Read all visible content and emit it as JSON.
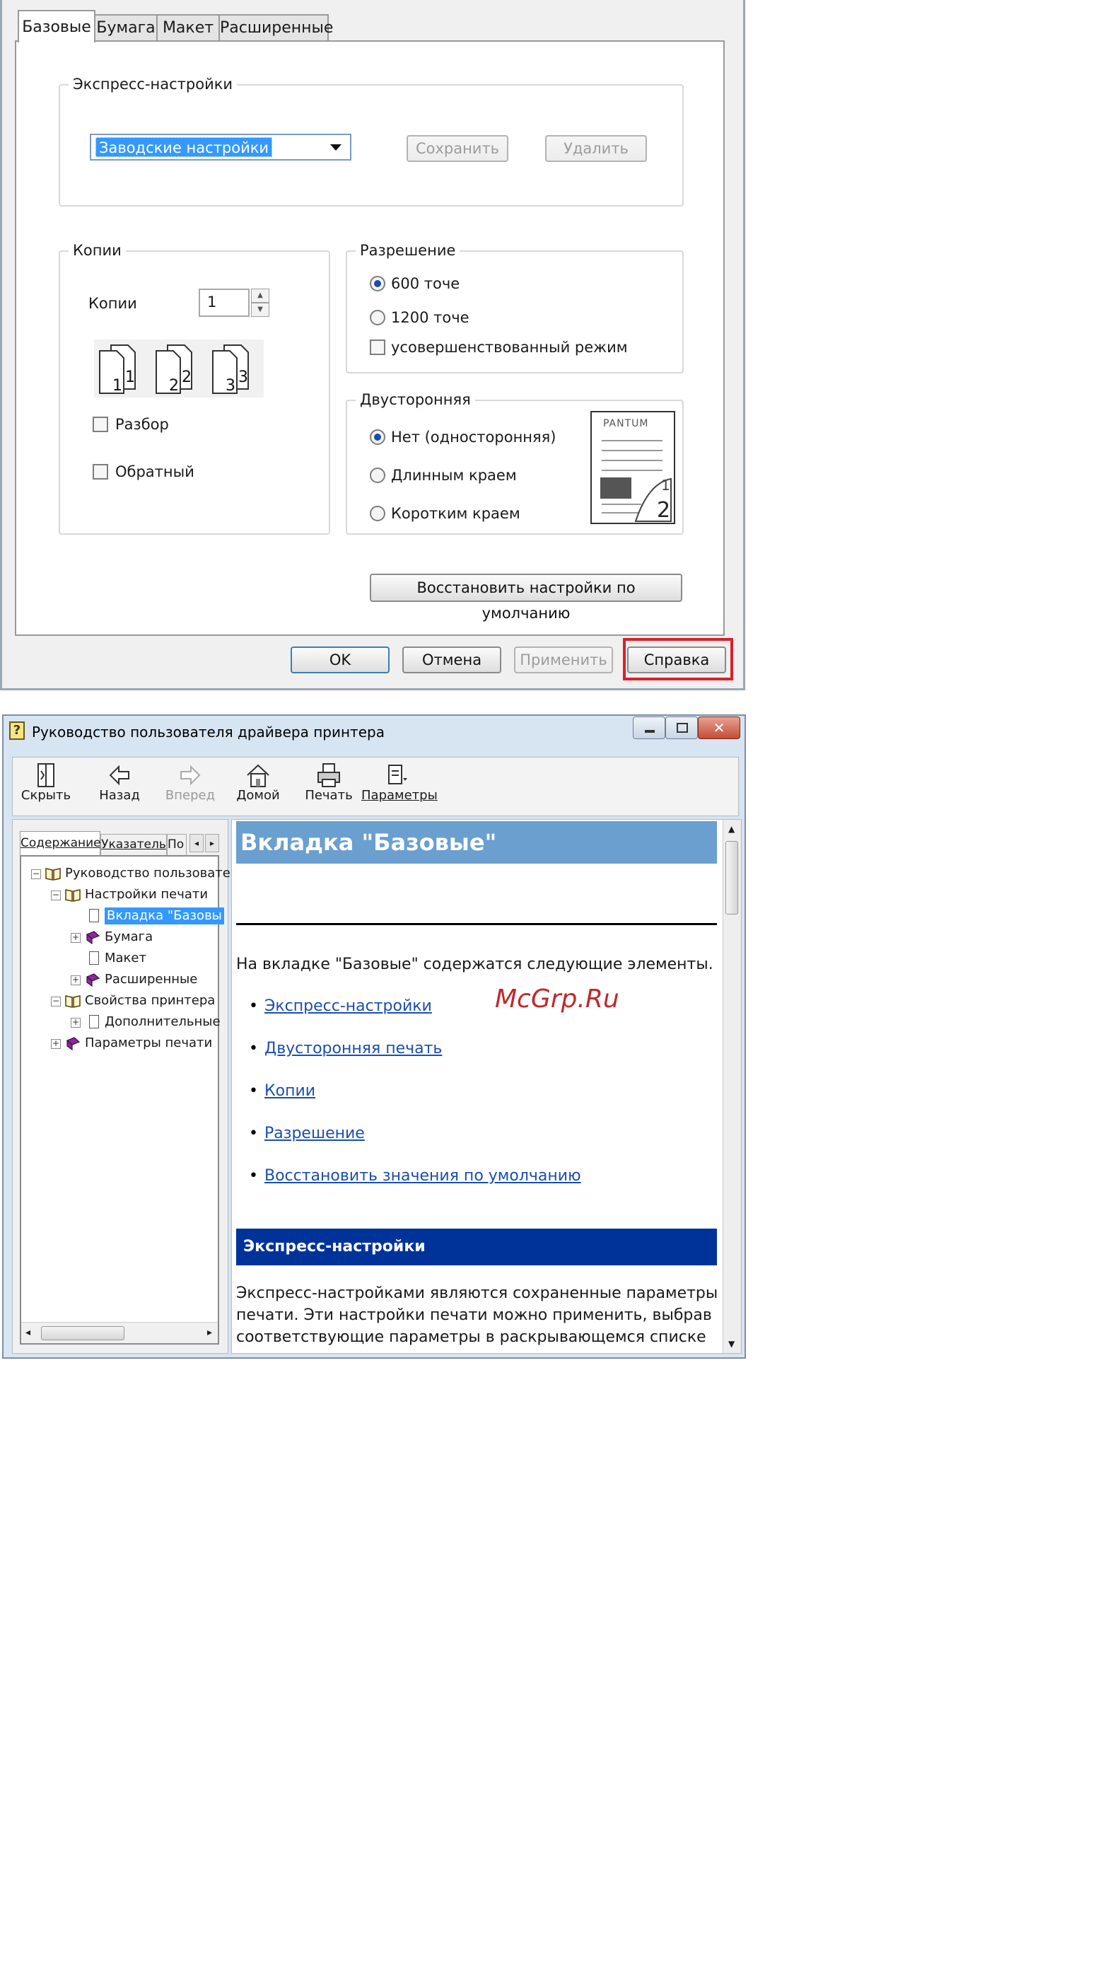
{
  "printer_dialog": {
    "tabs": [
      "Базовые",
      "Бумага",
      "Макет",
      "Расширенные"
    ],
    "express": {
      "title": "Экспресс-настройки",
      "selected": "Заводские настройки",
      "save": "Сохранить",
      "delete": "Удалить"
    },
    "copies": {
      "title": "Копии",
      "label": "Копии",
      "value": "1",
      "collate": "Разбор",
      "reverse": "Обратный"
    },
    "resolution": {
      "title": "Разрешение",
      "options": [
        "600 точе",
        "1200 точе"
      ],
      "selected_index": 0,
      "enhanced": "усовершенствованный режим"
    },
    "duplex": {
      "title": "Двусторонняя",
      "options": [
        "Нет (односторонняя)",
        "Длинным краем",
        "Коротким краем"
      ],
      "selected_index": 0,
      "preview_brand": "PANTUM"
    },
    "restore": "Восстановить настройки по умолчанию",
    "buttons": {
      "ok": "OK",
      "cancel": "Отмена",
      "apply": "Применить",
      "help": "Справка"
    },
    "colors": {
      "highlight_box": "#d9202a",
      "selection": "#3399ff"
    }
  },
  "help_window": {
    "title": "Руководство пользователя драйвера принтера",
    "toolbar": [
      "Скрыть",
      "Назад",
      "Вперед",
      "Домой",
      "Печать",
      "Параметры"
    ],
    "nav_tabs": [
      "Содержание",
      "Указатель",
      "По"
    ],
    "tree": [
      {
        "label": "Руководство пользовате"
      },
      {
        "label": "Настройки печати"
      },
      {
        "label": "Вкладка \"Базовы"
      },
      {
        "label": "Бумага"
      },
      {
        "label": "Макет"
      },
      {
        "label": "Расширенные"
      },
      {
        "label": "Свойства принтера"
      },
      {
        "label": "Дополнительные"
      },
      {
        "label": "Параметры печати"
      }
    ],
    "content": {
      "heading": "Вкладка \"Базовые\"",
      "intro": "На вкладке \"Базовые\" содержатся следующие элементы.",
      "links": [
        "Экспресс-настройки",
        "Двусторонняя печать",
        "Копии",
        "Разрешение",
        "Восстановить значения по умолчанию"
      ],
      "section_title": "Экспресс-настройки",
      "section_lines": [
        "Экспресс-настройками являются сохраненные параметры",
        "печати. Эти настройки печати можно применить, выбрав",
        "соответствующие параметры в раскрывающемся списке"
      ],
      "colors": {
        "heading_bg": "#6a9fd0",
        "section_bg": "#00339a"
      }
    },
    "watermark": "McGrp.Ru"
  }
}
